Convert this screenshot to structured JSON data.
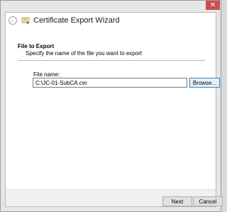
{
  "window": {
    "close_glyph": "✕",
    "title": "Certificate Export Wizard",
    "back_glyph": "←",
    "icons": {
      "back": "back-arrow-icon",
      "wizard": "certificate-icon",
      "close": "close-icon"
    }
  },
  "page": {
    "section_title": "File to Export",
    "section_description": "Specify the name of the file you want to export"
  },
  "form": {
    "file_name_label": "File name:",
    "file_name_value": "C:\\JC-01-SubCA.cer",
    "browse_label": "Browse..."
  },
  "footer": {
    "next_label": "Next",
    "cancel_label": "Cancel"
  },
  "colors": {
    "close_button": "#c75050",
    "focus_border": "#3c7fb1"
  }
}
